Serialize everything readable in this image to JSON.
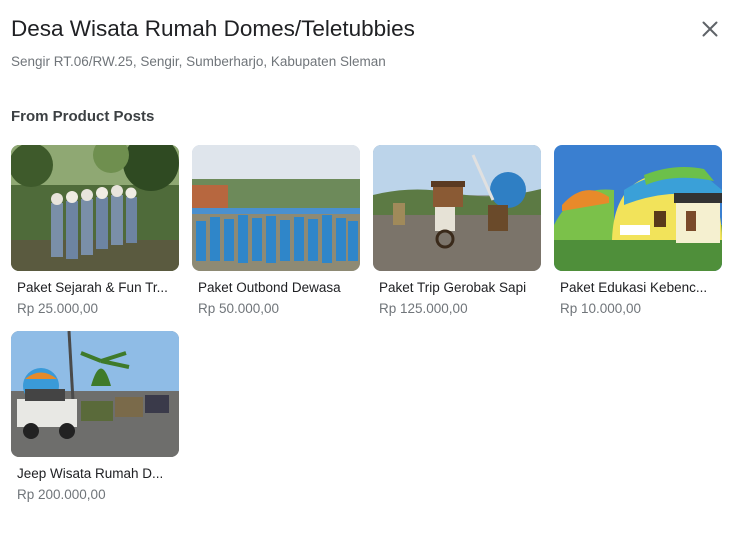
{
  "place": {
    "title": "Desa Wisata Rumah Domes/Teletubbies",
    "address": "Sengir RT.06/RW.25, Sengir, Sumberharjo, Kabupaten Sleman"
  },
  "section": {
    "heading": "From Product Posts"
  },
  "close_icon": "close-icon",
  "products": [
    {
      "name": "Paket Sejarah & Fun Tr...",
      "price": "Rp 25.000,00",
      "image": "students-photo"
    },
    {
      "name": "Paket Outbond Dewasa",
      "price": "Rp 50.000,00",
      "image": "group-photo"
    },
    {
      "name": "Paket Trip Gerobak Sapi",
      "price": "Rp 125.000,00",
      "image": "oxcart-photo"
    },
    {
      "name": "Paket Edukasi Kebenc...",
      "price": "Rp 10.000,00",
      "image": "dome-house-photo"
    },
    {
      "name": "Jeep Wisata Rumah D...",
      "price": "Rp 200.000,00",
      "image": "jeep-photo"
    }
  ]
}
